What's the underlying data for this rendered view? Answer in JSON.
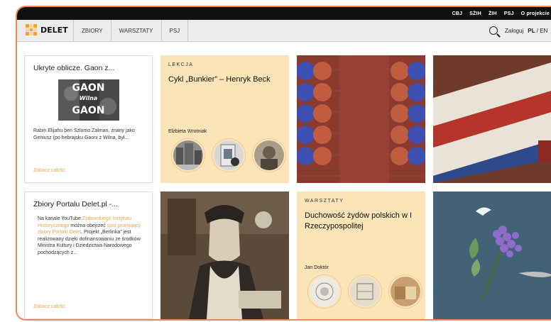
{
  "topbar": {
    "links": [
      "CBJ",
      "SŻIH",
      "ŻIH",
      "PSJ",
      "O projekcie"
    ]
  },
  "nav": {
    "logo": "DELET",
    "items": [
      "ZBIORY",
      "WARSZTATY",
      "PSJ"
    ],
    "login": "Zaloguj",
    "lang_active": "PL",
    "lang_sep": "/",
    "lang_other": "EN"
  },
  "cards": {
    "card1": {
      "title": "Ukryte oblicze. Gaon z...",
      "thumb_line1": "GAON",
      "thumb_line2": "Wilna",
      "thumb_line3": "GAON",
      "body": "Rabin Elijahu ben Szlomo Zalman, znany jako Geniusz (po hebrajsku Gaoni z Wilna, był...",
      "more": "Zobacz całość"
    },
    "card2": {
      "label": "LEKCJA",
      "title": "Cykl „Bunkier” – Henryk Beck",
      "author": "Elżbieta Wrotniak"
    },
    "card5": {
      "title": "Zbiory Portalu Delet.pl -...",
      "body_part1": "Na kanale YouTube ",
      "body_link1": "Żydowskiego Instytutu Historycznego",
      "body_part2": " można obejrzeć ",
      "body_link2": "spot promujący zbiory Portalu Delet",
      "body_part3": ". Projekt „Berlinka” jest realizowany dzięki dofinansowaniu ze środków Ministra Kultury i Dziedzictwa Narodowego pochodzących z...",
      "more": "Zobacz całość"
    },
    "card7": {
      "label": "WARSZTATY",
      "title": "Duchowość żydów polskich w I Rzeczypospolitej",
      "author": "Jan Doktór"
    }
  },
  "colors": {
    "accent": "#e8a64a",
    "cream": "#fde4b7",
    "frame": "#e88a55"
  }
}
